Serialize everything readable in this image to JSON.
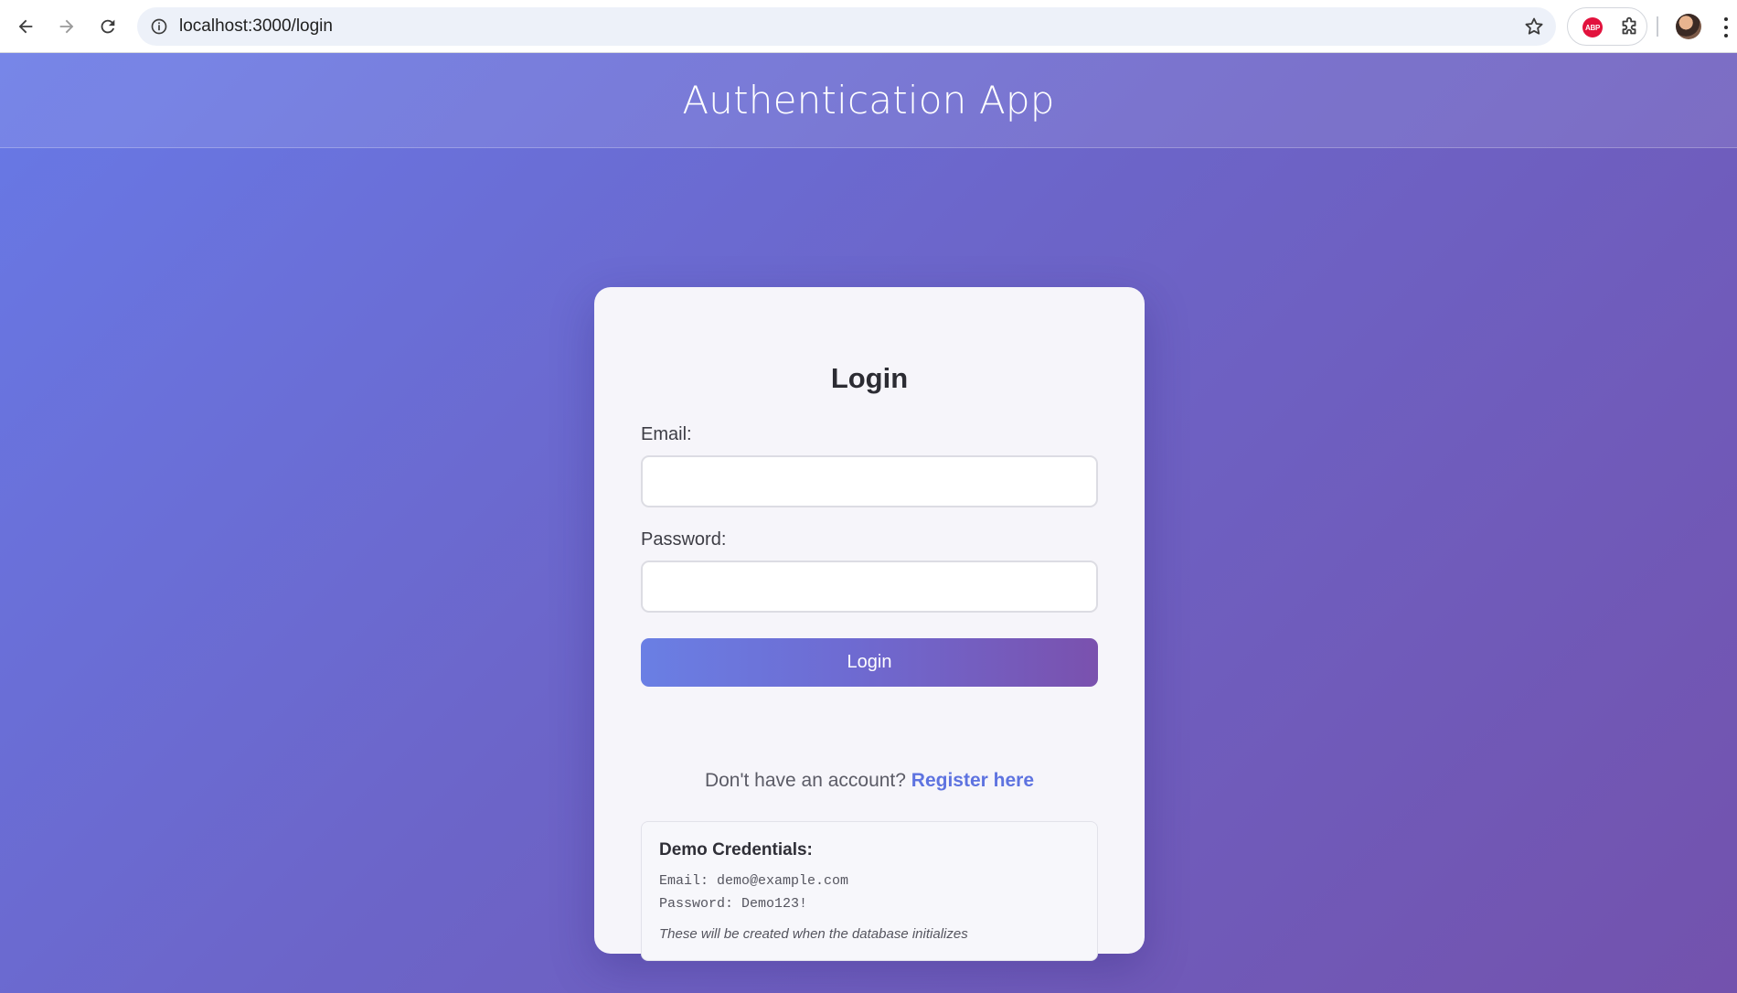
{
  "browser": {
    "url": "localhost:3000/login",
    "extension_badge": "ABP"
  },
  "app": {
    "title": "Authentication App"
  },
  "login_card": {
    "heading": "Login",
    "email_label": "Email:",
    "email_value": "",
    "password_label": "Password:",
    "password_value": "",
    "submit_label": "Login",
    "register_prompt": "Don't have an account?",
    "register_link": "Register here"
  },
  "demo": {
    "title": "Demo Credentials:",
    "email_line": "Email: demo@example.com",
    "password_line": "Password: Demo123!",
    "note": "These will be created when the database initializes"
  },
  "colors": {
    "bg_gradient_start": "#6879e6",
    "bg_gradient_end": "#7352ad",
    "link": "#5e73e0",
    "abp_red": "#e2123d"
  }
}
